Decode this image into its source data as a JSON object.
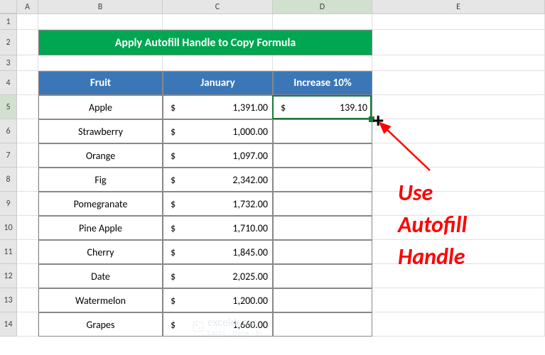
{
  "columns": [
    "A",
    "B",
    "C",
    "D",
    "E"
  ],
  "selected_column": "D",
  "selected_row": "5",
  "title": "Apply Autofill Handle to Copy Formula",
  "headers": {
    "fruit": "Fruit",
    "january": "January",
    "increase": "Increase 10%"
  },
  "rows": [
    {
      "n": "1"
    },
    {
      "n": "2"
    },
    {
      "n": "3"
    },
    {
      "n": "4"
    },
    {
      "n": "5",
      "fruit": "Apple",
      "jan": "1,391.00",
      "inc": "139.10"
    },
    {
      "n": "6",
      "fruit": "Strawberry",
      "jan": "1,000.00"
    },
    {
      "n": "7",
      "fruit": "Orange",
      "jan": "1,097.00"
    },
    {
      "n": "8",
      "fruit": "Fig",
      "jan": "2,342.00"
    },
    {
      "n": "9",
      "fruit": "Pomegranate",
      "jan": "1,732.00"
    },
    {
      "n": "10",
      "fruit": "Pine Apple",
      "jan": "1,710.00"
    },
    {
      "n": "11",
      "fruit": "Cherry",
      "jan": "1,845.00"
    },
    {
      "n": "12",
      "fruit": "Date",
      "jan": "2,025.00"
    },
    {
      "n": "13",
      "fruit": "Watermelon",
      "jan": "1,200.00"
    },
    {
      "n": "14",
      "fruit": "Grapes",
      "jan": "1,660.00"
    }
  ],
  "currency": "$",
  "annotation": {
    "line1": "Use",
    "line2": "Autofill",
    "line3": "Handle"
  },
  "watermark": {
    "brand": "exceldemy",
    "tag": "EXCEL · DATA · BI"
  },
  "chart_data": {
    "type": "table",
    "title": "Apply Autofill Handle to Copy Formula",
    "columns": [
      "Fruit",
      "January",
      "Increase 10%"
    ],
    "data": [
      [
        "Apple",
        1391.0,
        139.1
      ],
      [
        "Strawberry",
        1000.0,
        null
      ],
      [
        "Orange",
        1097.0,
        null
      ],
      [
        "Fig",
        2342.0,
        null
      ],
      [
        "Pomegranate",
        1732.0,
        null
      ],
      [
        "Pine Apple",
        1710.0,
        null
      ],
      [
        "Cherry",
        1845.0,
        null
      ],
      [
        "Date",
        2025.0,
        null
      ],
      [
        "Watermelon",
        1200.0,
        null
      ],
      [
        "Grapes",
        1660.0,
        null
      ]
    ]
  }
}
